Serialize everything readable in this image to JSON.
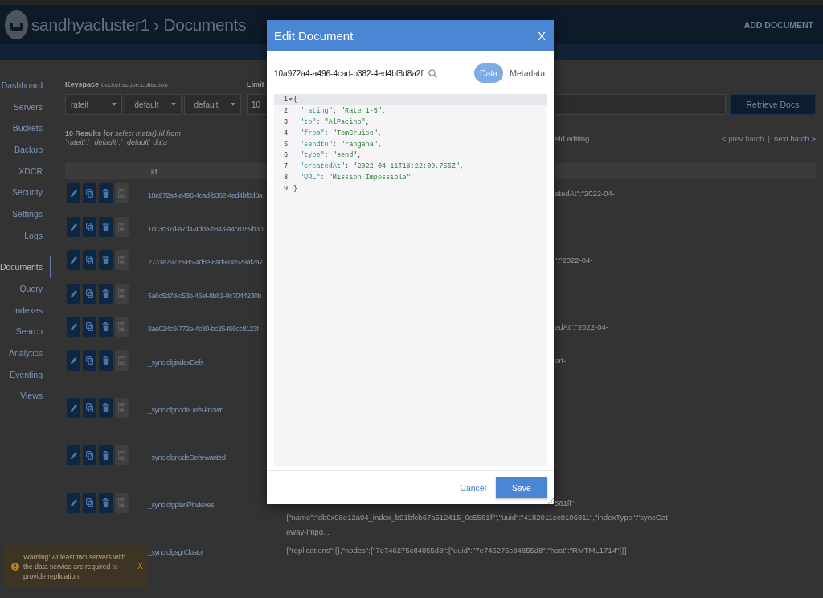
{
  "header": {
    "title": "sandhyacluster1 › Documents",
    "action": "ADD DOCUMENT"
  },
  "sidebar": {
    "groups": [
      {
        "items": [
          {
            "label": "Dashboard",
            "selected": false
          },
          {
            "label": "Servers",
            "selected": false
          },
          {
            "label": "Buckets",
            "selected": false
          },
          {
            "label": "Backup",
            "selected": false
          },
          {
            "label": "XDCR",
            "selected": false
          },
          {
            "label": "Security",
            "selected": false
          },
          {
            "label": "Settings",
            "selected": false
          },
          {
            "label": "Logs",
            "selected": false
          }
        ]
      },
      {
        "items": [
          {
            "label": "Documents",
            "selected": true
          },
          {
            "label": "Query",
            "selected": false
          },
          {
            "label": "Indexes",
            "selected": false
          },
          {
            "label": "Search",
            "selected": false
          },
          {
            "label": "Analytics",
            "selected": false
          },
          {
            "label": "Eventing",
            "selected": false
          },
          {
            "label": "Views",
            "selected": false
          }
        ]
      }
    ]
  },
  "filters": {
    "keyspace_label": "Keyspace",
    "keyspace_hint": "bucket.scope.collection",
    "dropdowns": [
      {
        "value": "rateit"
      },
      {
        "value": "_default"
      },
      {
        "value": "_default"
      }
    ],
    "limit_label": "Limit",
    "limit_value": "10",
    "submit": "Retrieve Docs"
  },
  "results": {
    "summary": "**10 Results for** *select meta().id from `rateit`.`_default`.`_default` data*",
    "summary_tail": "eld editing",
    "pagination": [
      {
        "label": "< prev batch",
        "disabled": true
      },
      {
        "label": "next batch >",
        "disabled": false
      }
    ],
    "pagination_separator": "|"
  },
  "table": {
    "id_column": "id",
    "rows": [
      {
        "kind": "document",
        "id": "10a972a4-a496-4cad-b382-4ed4bf8d8a",
        "buttons_shown": true,
        "save_disabled": true,
        "preview_tail": "atedAt\":\"2022-04-"
      },
      {
        "kind": "document",
        "id": "1c03c37d-a7d4-4dc0-b843-a4c8159b30",
        "buttons_shown": true,
        "save_disabled": true
      },
      {
        "kind": "document",
        "id": "2731e797-5985-4d8e-8ad9-0a529af2a7",
        "buttons_shown": true,
        "save_disabled": true,
        "preview_tail": "\":\"2022-04-"
      },
      {
        "kind": "document",
        "id": "5a6c5d7d-c53b-45ef-8b81-8c7044230b",
        "buttons_shown": true,
        "save_disabled": true
      },
      {
        "kind": "document",
        "id": "8ae024c9-772e-4c80-bc25-f66cc8123f",
        "buttons_shown": true,
        "save_disabled": true,
        "preview_tail": "edAt\":\"2022-04-"
      },
      {
        "kind": "config",
        "id": "_sync:cfgindexDefs",
        "buttons_shown": true,
        "save_disabled": true,
        "preview_tail": "ort-"
      },
      {
        "kind": "config",
        "id": "_sync:cfgnodeDefs-known",
        "buttons_shown": true,
        "save_disabled": true
      },
      {
        "kind": "config",
        "id": "_sync:cfgnodeDefs-wanted",
        "buttons_shown": true,
        "save_disabled": true
      },
      {
        "kind": "config",
        "id": "_sync:cfgplanPIndexes",
        "buttons_shown": true,
        "save_disabled": true,
        "preview_tail": "561ff\":",
        "preview": [
          "{\"name\":\"db0x98e12a94_index_b91bfcb67a512415_0c5561ff\",\"uuid\":\"4182011ec9106811\",\"indexType\":\"syncGat",
          "eway-impo..."
        ]
      },
      {
        "kind": "config",
        "id": "_sync:cfgsgrCluster",
        "buttons_shown": false,
        "preview": [
          "{\"replications\":{},\"nodes\":{\"7e746275c84855d8\":{\"uuid\":\"7e746275c84855d8\",\"host\":\"RMTML1714\"}}}"
        ]
      }
    ]
  },
  "warning": {
    "text": "Warning: At least two servers with the data service are required to provide replication.",
    "close": "X"
  },
  "dialog": {
    "title": "Edit Document",
    "close": "X",
    "document_id": "10a972a4-a496-4cad-b382-4ed4bf8d8a2f",
    "tabs": [
      {
        "label": "Data",
        "selected": true
      },
      {
        "label": "Metadata",
        "selected": false
      }
    ],
    "editor": {
      "lines": [
        {
          "number": "1",
          "kind": "brace",
          "fold": true,
          "active": true,
          "tokens": [
            {
              "kind": "punct",
              "text": "{"
            }
          ]
        },
        {
          "number": "2",
          "kind": "member",
          "fold": false,
          "active": false,
          "tokens": [
            {
              "kind": "key",
              "text": "\"rating\""
            },
            {
              "kind": "punct",
              "text": ": "
            },
            {
              "kind": "string",
              "text": "\"Rate 1-5\""
            },
            {
              "kind": "punct",
              "text": ","
            }
          ]
        },
        {
          "number": "3",
          "kind": "member",
          "fold": false,
          "active": false,
          "tokens": [
            {
              "kind": "key",
              "text": "\"to\""
            },
            {
              "kind": "punct",
              "text": ": "
            },
            {
              "kind": "string",
              "text": "\"AlPacino\""
            },
            {
              "kind": "punct",
              "text": ","
            }
          ]
        },
        {
          "number": "4",
          "kind": "member",
          "fold": false,
          "active": false,
          "tokens": [
            {
              "kind": "key",
              "text": "\"from\""
            },
            {
              "kind": "punct",
              "text": ": "
            },
            {
              "kind": "string",
              "text": "\"TomCruise\""
            },
            {
              "kind": "punct",
              "text": ","
            }
          ]
        },
        {
          "number": "5",
          "kind": "member",
          "fold": false,
          "active": false,
          "tokens": [
            {
              "kind": "key",
              "text": "\"sendto\""
            },
            {
              "kind": "punct",
              "text": ": "
            },
            {
              "kind": "string",
              "text": "\"rangana\""
            },
            {
              "kind": "punct",
              "text": ","
            }
          ]
        },
        {
          "number": "6",
          "kind": "member",
          "fold": false,
          "active": false,
          "tokens": [
            {
              "kind": "key",
              "text": "\"type\""
            },
            {
              "kind": "punct",
              "text": ": "
            },
            {
              "kind": "string",
              "text": "\"send\""
            },
            {
              "kind": "punct",
              "text": ","
            }
          ]
        },
        {
          "number": "7",
          "kind": "member",
          "fold": false,
          "active": false,
          "tokens": [
            {
              "kind": "key",
              "text": "\"createdAt\""
            },
            {
              "kind": "punct",
              "text": ": "
            },
            {
              "kind": "string",
              "text": "\"2022-04-11T18:22:09.755Z\""
            },
            {
              "kind": "punct",
              "text": ","
            }
          ]
        },
        {
          "number": "8",
          "kind": "member",
          "fold": false,
          "active": false,
          "tokens": [
            {
              "kind": "key",
              "text": "\"URL\""
            },
            {
              "kind": "punct",
              "text": ": "
            },
            {
              "kind": "string",
              "text": "\"Mission Impossible\""
            }
          ]
        },
        {
          "number": "9",
          "kind": "brace",
          "fold": false,
          "active": false,
          "tokens": [
            {
              "kind": "punct",
              "text": "}"
            }
          ]
        }
      ]
    },
    "buttons": [
      {
        "label": "Cancel",
        "kind": "link"
      },
      {
        "label": "Save",
        "kind": "primary"
      }
    ]
  }
}
